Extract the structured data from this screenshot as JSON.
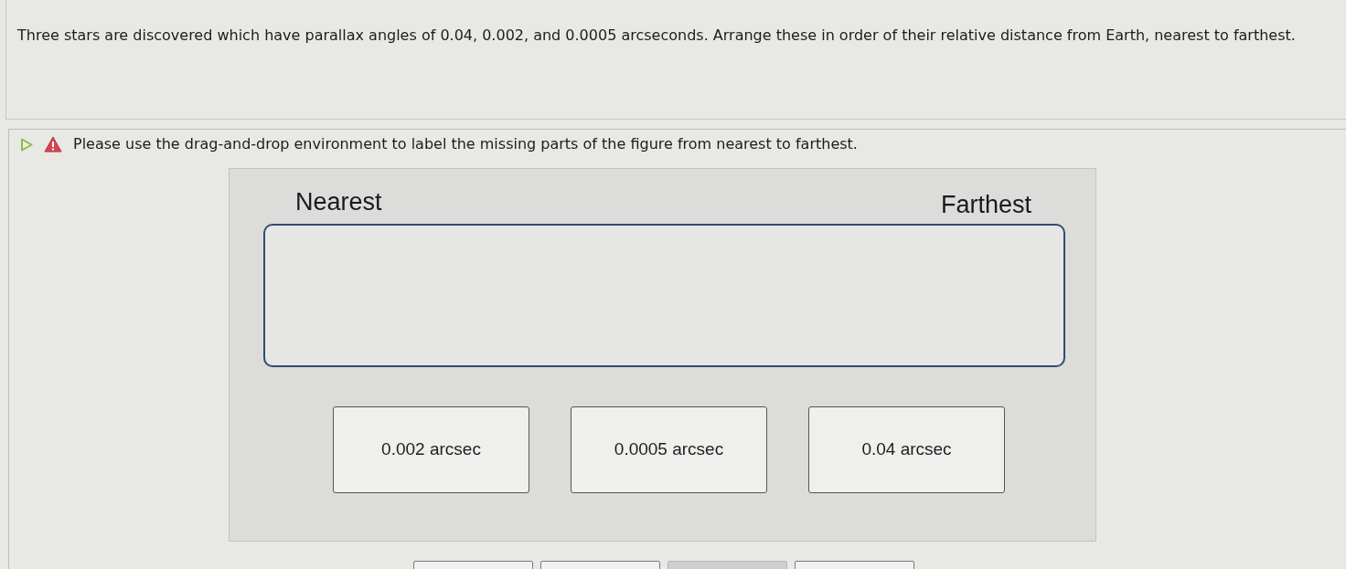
{
  "question": {
    "text": "Three stars are discovered which have parallax angles of 0.04, 0.002, and 0.0005 arcseconds. Arrange these in order of their relative distance from Earth, nearest to farthest."
  },
  "instruction": {
    "text": "Please use the drag-and-drop environment to label the missing parts of the figure from nearest to farthest."
  },
  "figure": {
    "left_label": "Nearest",
    "right_label": "Farthest",
    "labels": [
      {
        "text": "0.002 arcsec"
      },
      {
        "text": "0.0005 arcsec"
      },
      {
        "text": "0.04 arcsec"
      }
    ]
  },
  "buttons": [
    {
      "disabled": false
    },
    {
      "disabled": false
    },
    {
      "disabled": true
    },
    {
      "disabled": false
    }
  ]
}
